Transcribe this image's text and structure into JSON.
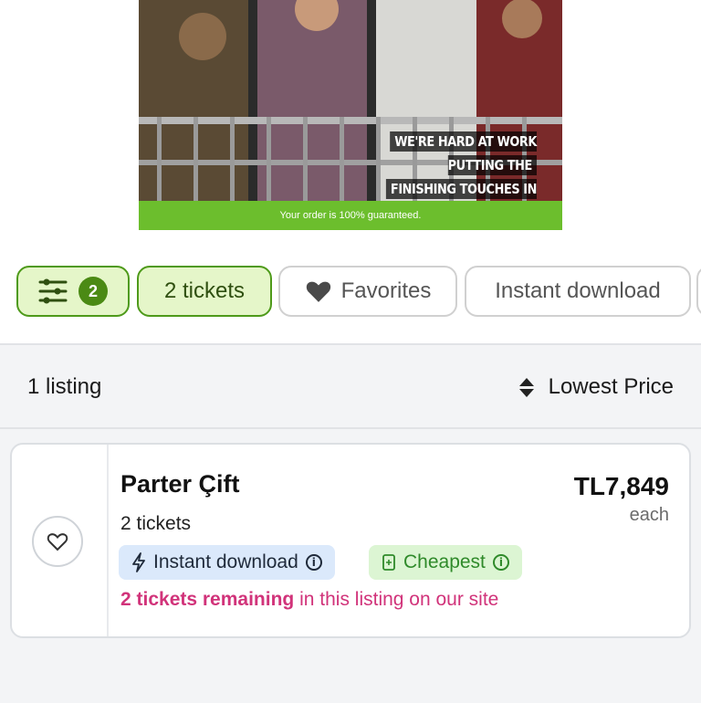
{
  "banner": {
    "message_line1": "WE'RE HARD AT WORK PUTTING THE",
    "message_line2": "FINISHING TOUCHES IN PLACE",
    "guarantee": "Your order is 100% guaranteed.",
    "guarantee_color": "#6cbe2d"
  },
  "filters": {
    "filter_count": "2",
    "tickets_label": "2 tickets",
    "favorites_label": "Favorites",
    "instant_label": "Instant download",
    "active_color": "#e5f6c9",
    "active_border": "#4e9a1a"
  },
  "summary": {
    "listing_count": "1 listing",
    "sort_label": "Lowest Price"
  },
  "listing": {
    "section": "Parter Çift",
    "quantity": "2 tickets",
    "price": "TL7,849",
    "price_unit": "each",
    "badge_instant": "Instant download",
    "badge_cheapest": "Cheapest",
    "remaining_bold": "2 tickets remaining",
    "remaining_rest": " in this listing on our site",
    "remaining_color": "#d1337a"
  },
  "icons": {
    "filter": "sliders-icon",
    "favorites": "heart-icon",
    "sort": "sort-arrows-icon",
    "favorite_toggle": "heart-outline-icon",
    "instant": "lightning-icon",
    "cheapest": "tag-icon",
    "info": "info-icon"
  }
}
